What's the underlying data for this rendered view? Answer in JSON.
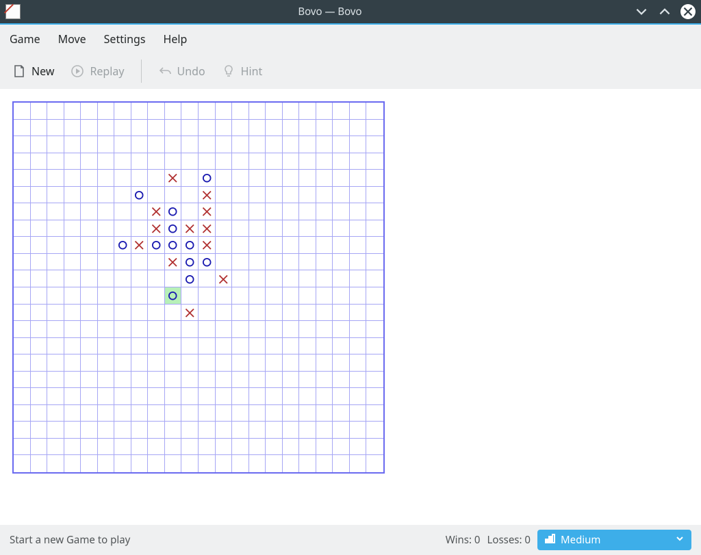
{
  "window": {
    "title": "Bovo — Bovo"
  },
  "menubar": [
    "Game",
    "Move",
    "Settings",
    "Help"
  ],
  "toolbar": {
    "new": "New",
    "replay": "Replay",
    "undo": "Undo",
    "hint": "Hint"
  },
  "board": {
    "cols": 22,
    "rows": 22,
    "highlight": {
      "r": 11,
      "c": 9
    },
    "pieces": [
      {
        "r": 4,
        "c": 9,
        "t": "X"
      },
      {
        "r": 4,
        "c": 11,
        "t": "O"
      },
      {
        "r": 5,
        "c": 7,
        "t": "O"
      },
      {
        "r": 5,
        "c": 11,
        "t": "X"
      },
      {
        "r": 6,
        "c": 8,
        "t": "X"
      },
      {
        "r": 6,
        "c": 9,
        "t": "O"
      },
      {
        "r": 6,
        "c": 11,
        "t": "X"
      },
      {
        "r": 7,
        "c": 8,
        "t": "X"
      },
      {
        "r": 7,
        "c": 9,
        "t": "O"
      },
      {
        "r": 7,
        "c": 10,
        "t": "X"
      },
      {
        "r": 7,
        "c": 11,
        "t": "X"
      },
      {
        "r": 8,
        "c": 6,
        "t": "O"
      },
      {
        "r": 8,
        "c": 7,
        "t": "X"
      },
      {
        "r": 8,
        "c": 8,
        "t": "O"
      },
      {
        "r": 8,
        "c": 9,
        "t": "O"
      },
      {
        "r": 8,
        "c": 10,
        "t": "O"
      },
      {
        "r": 8,
        "c": 11,
        "t": "X"
      },
      {
        "r": 9,
        "c": 9,
        "t": "X"
      },
      {
        "r": 9,
        "c": 10,
        "t": "O"
      },
      {
        "r": 9,
        "c": 11,
        "t": "O"
      },
      {
        "r": 10,
        "c": 10,
        "t": "O"
      },
      {
        "r": 10,
        "c": 12,
        "t": "X"
      },
      {
        "r": 11,
        "c": 9,
        "t": "O"
      },
      {
        "r": 12,
        "c": 10,
        "t": "X"
      }
    ]
  },
  "status": {
    "message": "Start a new Game to play",
    "wins_label": "Wins:",
    "wins": 0,
    "losses_label": "Losses:",
    "losses": 0
  },
  "difficulty": {
    "selected": "Medium"
  }
}
